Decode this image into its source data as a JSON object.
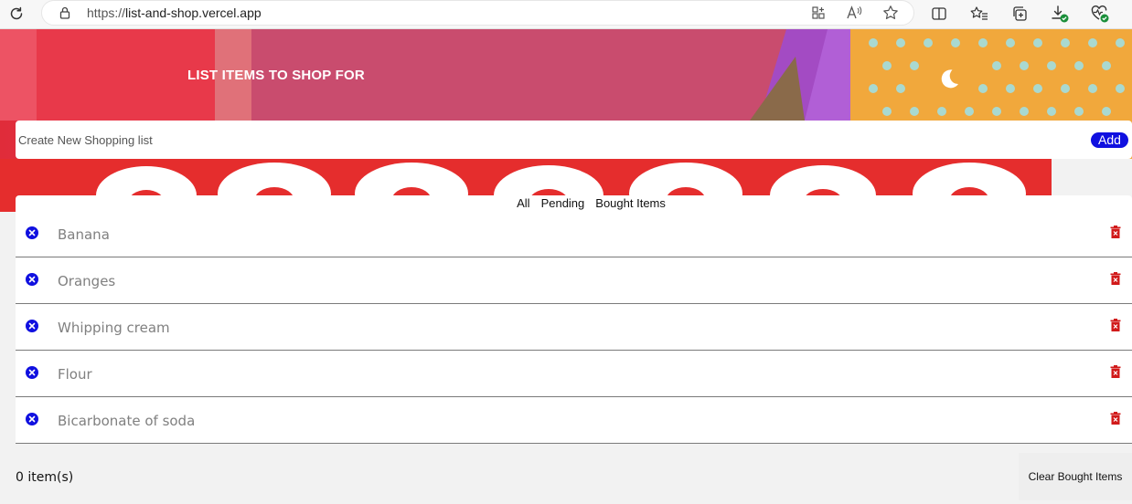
{
  "browser": {
    "url_protocol": "https://",
    "url_host": "list-and-shop.vercel.app",
    "icons": [
      "reload-icon",
      "lock-icon",
      "app-available-icon",
      "read-aloud-icon",
      "favorite-star-icon",
      "split-screen-icon",
      "favorites-icon",
      "collections-icon",
      "downloads-icon",
      "browser-essentials-icon"
    ]
  },
  "header": {
    "title": "LIST ITEMS TO SHOP FOR",
    "theme_icon": "moon-icon"
  },
  "new_list": {
    "placeholder": "Create New Shopping list",
    "add_label": "Add"
  },
  "filters": [
    {
      "label": "All"
    },
    {
      "label": "Pending"
    },
    {
      "label": "Bought Items"
    }
  ],
  "items": [
    {
      "name": "Banana"
    },
    {
      "name": "Oranges"
    },
    {
      "name": "Whipping cream"
    },
    {
      "name": "Flour"
    },
    {
      "name": "Bicarbonate of soda"
    }
  ],
  "footer": {
    "count_text": "0 item(s)",
    "clear_label": "Clear Bought Items"
  },
  "colors": {
    "accent_blue": "#1010e0",
    "delete_red": "#d11a1a",
    "item_text": "#808080"
  }
}
